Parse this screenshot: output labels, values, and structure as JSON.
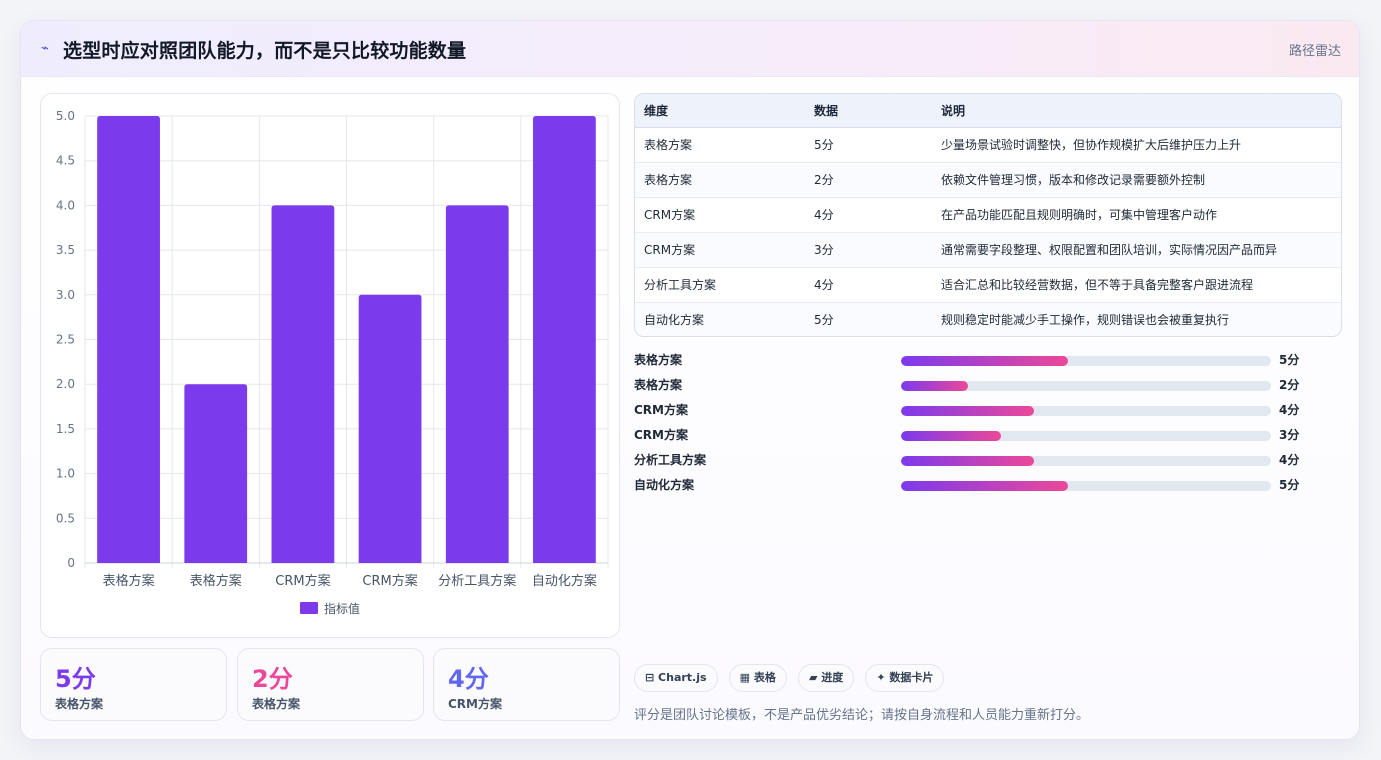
{
  "header": {
    "icon": "signal-icon",
    "title": "选型时应对照团队能力，而不是只比较功能数量",
    "tag": "路径雷达"
  },
  "chart_data": {
    "type": "bar",
    "categories": [
      "表格方案",
      "表格方案",
      "CRM方案",
      "CRM方案",
      "分析工具方案",
      "自动化方案"
    ],
    "series": [
      {
        "name": "指标值",
        "values": [
          5,
          2,
          4,
          3,
          4,
          5
        ],
        "color": "#7c3aed"
      }
    ],
    "ylim": [
      0,
      5
    ],
    "yticks": [
      "0",
      "0.5",
      "1.0",
      "1.5",
      "2.0",
      "2.5",
      "3.0",
      "3.5",
      "4.0",
      "4.5",
      "5.0"
    ],
    "legend": "bottom",
    "grid": true
  },
  "stats": [
    {
      "value": "5分",
      "label": "表格方案",
      "color": "#7c3aed"
    },
    {
      "value": "2分",
      "label": "表格方案",
      "color": "#ec4899"
    },
    {
      "value": "4分",
      "label": "CRM方案",
      "color": "#6366f1"
    }
  ],
  "table": {
    "headers": [
      "维度",
      "数据",
      "说明"
    ],
    "rows": [
      [
        "表格方案",
        "5分",
        "少量场景试验时调整快，但协作规模扩大后维护压力上升"
      ],
      [
        "表格方案",
        "2分",
        "依赖文件管理习惯，版本和修改记录需要额外控制"
      ],
      [
        "CRM方案",
        "4分",
        "在产品功能匹配且规则明确时，可集中管理客户动作"
      ],
      [
        "CRM方案",
        "3分",
        "通常需要字段整理、权限配置和团队培训，实际情况因产品而异"
      ],
      [
        "分析工具方案",
        "4分",
        "适合汇总和比较经营数据，但不等于具备完整客户跟进流程"
      ],
      [
        "自动化方案",
        "5分",
        "规则稳定时能减少手工操作，规则错误也会被重复执行"
      ]
    ]
  },
  "progress": [
    {
      "label": "表格方案",
      "value_text": "5分",
      "fraction": 0.45
    },
    {
      "label": "表格方案",
      "value_text": "2分",
      "fraction": 0.18
    },
    {
      "label": "CRM方案",
      "value_text": "4分",
      "fraction": 0.36
    },
    {
      "label": "CRM方案",
      "value_text": "3分",
      "fraction": 0.27
    },
    {
      "label": "分析工具方案",
      "value_text": "4分",
      "fraction": 0.36
    },
    {
      "label": "自动化方案",
      "value_text": "5分",
      "fraction": 0.45
    }
  ],
  "pills": [
    "⊟ Chart.js",
    "▦ 表格",
    "▰ 进度",
    "✦ 数据卡片"
  ],
  "footnote": "评分是团队讨论模板，不是产品优劣结论；请按自身流程和人员能力重新打分。"
}
